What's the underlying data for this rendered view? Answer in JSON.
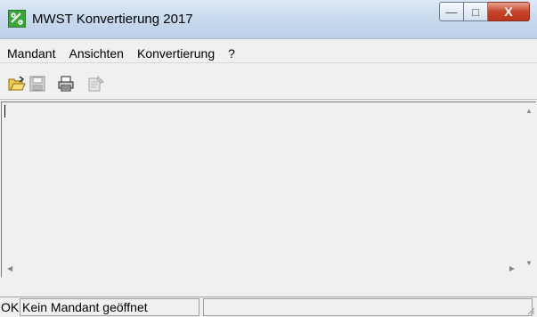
{
  "window": {
    "title": "MWST Konvertierung 2017",
    "controls": {
      "minimize": "—",
      "maximize": "□",
      "close": "X"
    }
  },
  "menu": {
    "items": [
      "Mandant",
      "Ansichten",
      "Konvertierung",
      "?"
    ]
  },
  "toolbar": {
    "buttons": [
      {
        "name": "open-icon",
        "enabled": true
      },
      {
        "name": "save-icon",
        "enabled": false
      },
      {
        "name": "print-icon",
        "enabled": true
      },
      {
        "name": "properties-icon",
        "enabled": false
      }
    ]
  },
  "content": {
    "text": ""
  },
  "status": {
    "ok": "OK",
    "message": "Kein Mandant geöffnet",
    "extra": ""
  },
  "colors": {
    "accent_close": "#c7452b",
    "app_icon": "#3aa63a"
  }
}
